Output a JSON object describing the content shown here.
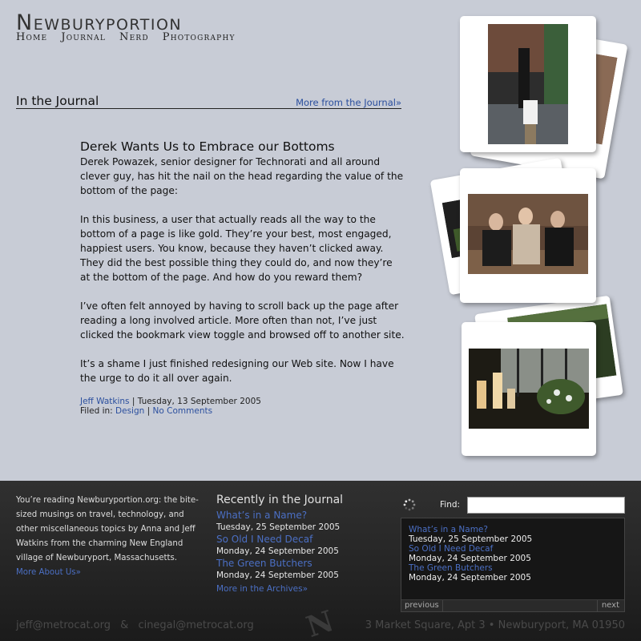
{
  "header": {
    "site_title": "Newburyportion",
    "nav": [
      "Home",
      "Journal",
      "Nerd",
      "Photography"
    ]
  },
  "section": {
    "title": "In the Journal",
    "more_link": "More from the Journal»"
  },
  "article": {
    "title": "Derek Wants Us to Embrace our Bottoms",
    "paragraphs": [
      "Derek Powazek, senior designer for Technorati and all around clever guy, has hit the nail on the head regarding the value of the bottom of the page:",
      "In this business, a user that actually reads all the way to the bottom of a page is like gold. They’re your best, most engaged, happiest users. You know, because they haven’t clicked away. They did the best possible thing they could do, and now they’re at the bottom of the page. And how do you reward them?",
      "I’ve often felt annoyed by having to scroll back up the page after reading a long involved article. More often than not, I’ve just clicked the bookmark view toggle and browsed off to another site.",
      "It’s a shame I just finished redesigning our Web site. Now I have the urge to do it all over again."
    ],
    "author": "Jeff Watkins",
    "separator": "|",
    "date": "Tuesday, 13 September 2005",
    "filed_in_label": "Filed in:",
    "category": "Design",
    "comments": "No Comments"
  },
  "footer": {
    "about_text": "You’re reading Newburyportion.org: the bite-sized musings on travel, technology, and other miscellaneous topics by Anna and Jeff Watkins from the charming New England village of Newburyport, Massachusetts.",
    "about_link": "More About Us»",
    "recent_heading": "Recently in the Journal",
    "recent_items": [
      {
        "title": "What’s in a Name?",
        "date": "Tuesday, 25 September 2005"
      },
      {
        "title": "So Old I Need Decaf",
        "date": "Monday, 24 September 2005"
      },
      {
        "title": "The Green Butchers",
        "date": "Monday, 24 September 2005"
      }
    ],
    "archives_link": "More in the Archives»",
    "find_label": "Find:",
    "find_value": "",
    "results": [
      {
        "title": "What’s in a Name?",
        "date": "Tuesday, 25 September 2005"
      },
      {
        "title": "So Old I Need Decaf",
        "date": "Monday, 24 September 2005"
      },
      {
        "title": "The Green Butchers",
        "date": "Monday, 24 September 2005"
      }
    ],
    "prev_label": "previous",
    "next_label": "next",
    "contact_email_1": "jeff@metrocat.org",
    "contact_amp": "&",
    "contact_email_2": "cinegal@metrocat.org",
    "address": "3 Market Square, Apt 3 • Newburyport, MA 01950",
    "logo_letter": "N"
  }
}
